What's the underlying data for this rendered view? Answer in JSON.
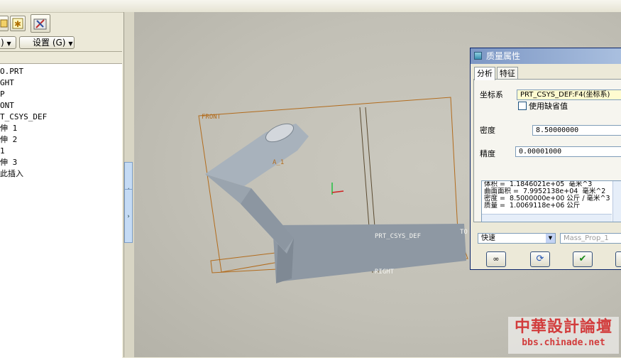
{
  "toolbar": {
    "dropdown1_label": ")",
    "dropdown2_label": "设置 (G)"
  },
  "model_tree": {
    "items": [
      "O.PRT",
      "GHT",
      "P",
      "ONT",
      "T_CSYS_DEF",
      "伸 1",
      "伸 2",
      " 1",
      "伸 3",
      "此插入"
    ]
  },
  "viewport": {
    "datum_labels": {
      "front": "FRONT",
      "right": "RIGHT",
      "top": "TO",
      "csys": "PRT_CSYS_DEF",
      "axis": "A_1"
    }
  },
  "dialog": {
    "title": "质量属性",
    "tabs": [
      "分析",
      "特征"
    ],
    "active_tab": "分析",
    "csys_label": "坐标系",
    "csys_value": "PRT_CSYS_DEF:F4(坐标系)",
    "use_default_label": "使用缺省值",
    "density_label": "密度",
    "density_value": "8.50000000",
    "accuracy_label": "精度",
    "accuracy_value": "0.00001000",
    "results": [
      "体积 =  1.1846021e+05  毫米^3",
      "曲面面积 =  7.9952138e+04  毫米^2",
      "密度 =  8.5000000e+00 公斤 / 毫米^3",
      "质量 =  1.0069118e+06 公斤"
    ],
    "mode_value": "快速",
    "name_placeholder": "Mass_Prop_1"
  },
  "watermark": {
    "line1": "中華設計論壇",
    "line2": "bbs.chinade.net"
  },
  "icons": {
    "toolbar1": "folder-icon",
    "toolbar2": "star-icon",
    "toolbar3": "tools-icon",
    "sash_left": "arrow-left-icon",
    "sash_right": "arrow-right-icon",
    "glasses": "glasses-icon",
    "refresh": "refresh-icon",
    "ok": "checkmark-icon"
  },
  "colors": {
    "datum": "#b26b1c",
    "part": "#9ea8b3",
    "watermark": "#d23c3c"
  }
}
